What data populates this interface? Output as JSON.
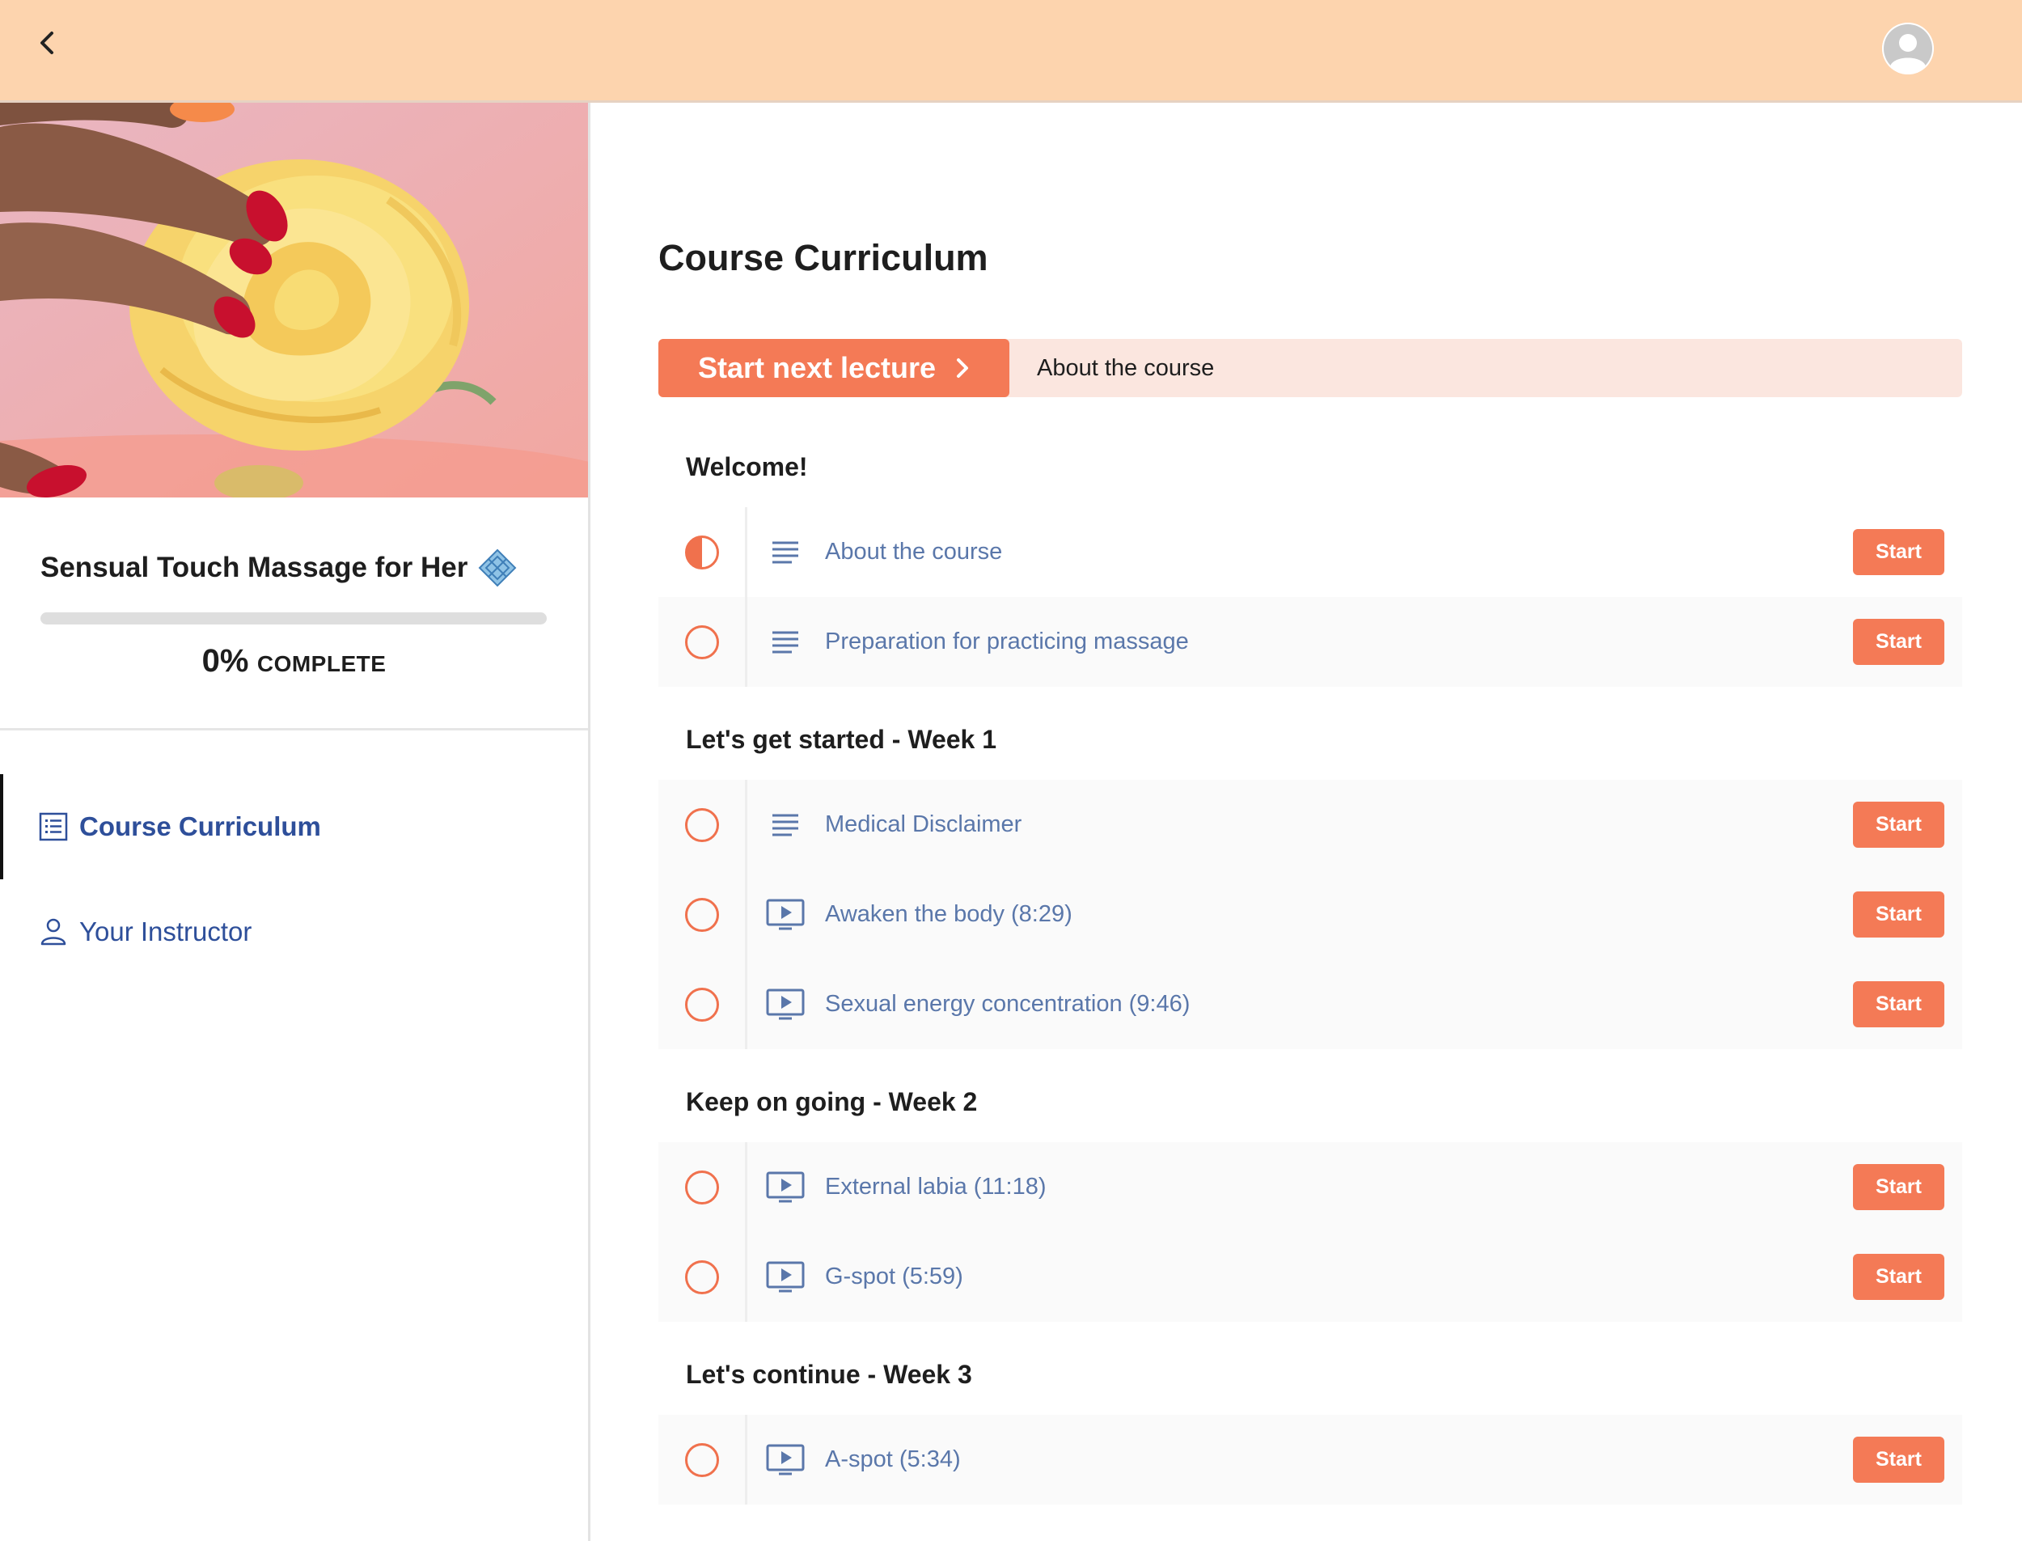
{
  "header": {
    "back_icon": "chevron-left-icon",
    "avatar_icon": "user-avatar-icon"
  },
  "sidebar": {
    "course_title": "Sensual Touch Massage for Her",
    "progress": {
      "percent_value": 0,
      "percent_text": "0%",
      "label": "COMPLETE"
    },
    "nav": [
      {
        "label": "Course Curriculum",
        "icon": "list-icon",
        "active": true
      },
      {
        "label": "Your Instructor",
        "icon": "person-icon",
        "active": false
      }
    ]
  },
  "main": {
    "title": "Course Curriculum",
    "next_button_label": "Start next lecture",
    "next_lecture": "About the course",
    "start_label": "Start",
    "sections": [
      {
        "title": "Welcome!",
        "lectures": [
          {
            "name": "About the course",
            "type": "text",
            "status": "in-progress"
          },
          {
            "name": "Preparation for practicing massage",
            "type": "text",
            "status": "not-started"
          }
        ]
      },
      {
        "title": "Let's get started - Week 1",
        "lectures": [
          {
            "name": "Medical Disclaimer",
            "type": "text",
            "status": "not-started"
          },
          {
            "name": "Awaken the body (8:29)",
            "type": "video",
            "status": "not-started"
          },
          {
            "name": "Sexual energy concentration (9:46)",
            "type": "video",
            "status": "not-started"
          }
        ]
      },
      {
        "title": "Keep on going - Week 2",
        "lectures": [
          {
            "name": "External labia (11:18)",
            "type": "video",
            "status": "not-started"
          },
          {
            "name": "G-spot (5:59)",
            "type": "video",
            "status": "not-started"
          }
        ]
      },
      {
        "title": "Let's continue - Week 3",
        "lectures": [
          {
            "name": "A-spot (5:34)",
            "type": "video",
            "status": "not-started"
          }
        ]
      }
    ]
  },
  "colors": {
    "accent": "#f47a56",
    "topbar": "#fdd4ae",
    "link": "#2e4f9a",
    "lecture_text": "#5a77aa"
  }
}
